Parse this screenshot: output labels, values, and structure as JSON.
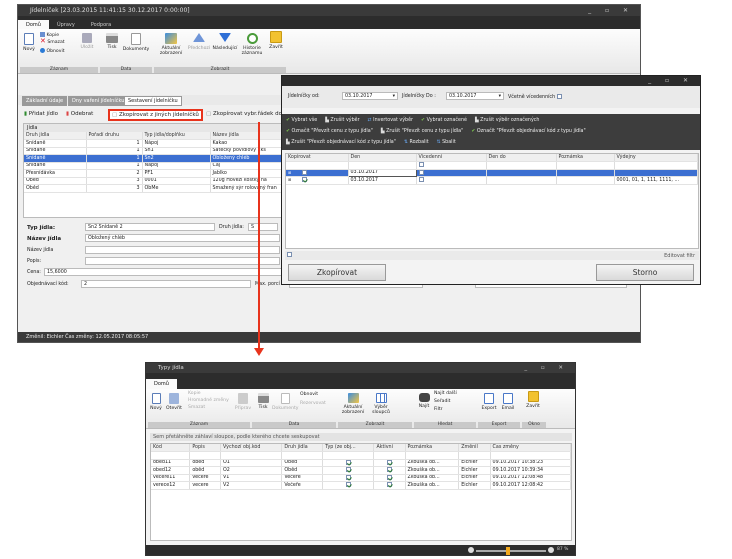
{
  "main": {
    "title": "Jídelníček [23.03.2015 11:41:15 30.12.2017 0:00:00]",
    "menu": [
      "Domů",
      "Úpravy",
      "Podpora"
    ],
    "ribbon": {
      "kopie": "Kopie",
      "smazat": "Smazat",
      "novy": "Nový",
      "obnovit": "Obnovit",
      "ulozit": "Uložit",
      "tisk": "Tisk",
      "dokumenty": "Dokumenty",
      "aktualni": "Aktuální zobrazení",
      "predchozi": "Předchozí",
      "nasledujici": "Následující",
      "historie": "Historie záznamu",
      "zavrit": "Zavřít",
      "groups": [
        "Záznam",
        "Data",
        "Zobrazit"
      ]
    },
    "tabs": [
      "Základní údaje",
      "Dny vaření jídelníčku",
      "Sestavení jídelníčku"
    ],
    "toolbar": {
      "pridat": "Přidat jídlo",
      "odebrat": "Odebrat",
      "zkopirovat": "Zkopírovat z jiných jídelníčků",
      "zkopirovat_vybr": "Zkopírovat vybr.řádek do"
    },
    "grid_title": "Jídla",
    "columns": [
      "Druh jídla",
      "Pořadí druhu",
      "Typ jídla/doplňku",
      "Název jídla"
    ],
    "rows": [
      [
        "Snídaně",
        "1",
        "Nápoj",
        "Kakao"
      ],
      [
        "Snídaně",
        "1",
        "Sn1",
        "Šátečky povidlový 2ks"
      ],
      [
        "Snídaně",
        "1",
        "Sn2",
        "Obložený chléb"
      ],
      [
        "Snídaně",
        "1",
        "Nápoj",
        "Čaj"
      ],
      [
        "Přesnídávka",
        "2",
        "PF1",
        "Jablko"
      ],
      [
        "Oběd",
        "3",
        "0001",
        "120g Hovězí kostky na"
      ],
      [
        "Oběd",
        "3",
        "ObMe",
        "Smažený sýr rolovaný fran"
      ]
    ],
    "form": {
      "typ_label": "Typ jídla:",
      "typ_value": "Sn2 Snídaně 2",
      "druh_label": "Druh jídla:",
      "druh_value": "S",
      "nazev_label": "Název jídla",
      "nazev_value": "Obložený chléb",
      "nazev2_label": "Název jídla",
      "popis_label": "Popis:",
      "cena_label": "Cena:",
      "cena_value": "15,6000",
      "obj_label": "Objednávací kód:",
      "obj_value": "2",
      "max_label": "Max. porcí ceny:",
      "max_value": "0",
      "denni_label": "Denní rezervace:",
      "denni_value": "6",
      "na_label": "Na"
    },
    "status": "Změnil: Eichler  Čas změny: 12.05.2017 08:05:57"
  },
  "dialog": {
    "od_label": "Jídelníčky od:",
    "od_value": "03.10.2017",
    "do_label": "Jídelníčky Do :",
    "do_value": "03.10.2017",
    "vcetne": "Včetně vícedenních",
    "actions1": [
      "Vybrat vše",
      "Zrušit výběr",
      "Invertovat výběr",
      "Vybrat označené",
      "Zrušit výběr označených"
    ],
    "actions2": [
      "Označit \"Převzít cenu z typu jídla\"",
      "Zrušit \"Převzít cenu z typu jídla\"",
      "Označit \"Převzít objednávací kód z typu jídla\""
    ],
    "actions3": [
      "Zrušit \"Převzít objednávací kód z typu jídla\"",
      "Rozbalit",
      "Sbalit"
    ],
    "columns": [
      "Kopírovat",
      "Den",
      "Vícedenní",
      "Den do",
      "Poznámka",
      "Výdejny"
    ],
    "rows": [
      {
        "den": "03.10.2017",
        "vydejny": "",
        "checked": false
      },
      {
        "den": "03.10.2017",
        "vydejny": "0001, 01, 1, 111, 1111, ...",
        "checked": true
      }
    ],
    "editovat": "Editovat filtr",
    "zkopirovat": "Zkopírovat",
    "storno": "Storno"
  },
  "second": {
    "title": "Typy jídla",
    "menu": [
      "Domů"
    ],
    "ribbon": {
      "novy": "Nový",
      "otevrit": "Otevřít",
      "kopie": "Kopie",
      "hromadne": "Hromadné změny",
      "smazat": "Smazat",
      "priprav": "Připrav",
      "tisk": "Tisk",
      "dokumenty": "Dokumenty",
      "obnovit": "Obnovit",
      "rezervovat": "Rezervovat",
      "aktualni": "Aktuální zobrazení",
      "vyber": "Výběr sloupců",
      "najit": "Najít",
      "najit_dalsi": "Najít další",
      "seradit": "Seřadit",
      "filtr": "Filtr",
      "export": "Export",
      "email": "Email",
      "zavrit": "Zavřít",
      "groups": [
        "Záznam",
        "Data",
        "Zobrazit",
        "Hledat",
        "Export",
        "Okno"
      ]
    },
    "hint": "Sem přetáhněte záhlaví sloupce, podle kterého chcete seskupovat",
    "columns": [
      "Kód",
      "Popis",
      "Výchozí obj.kód",
      "Druh jídla",
      "Typ (ze obj...",
      "Aktivní",
      "Poznámka",
      "Změnil",
      "Čas změny"
    ],
    "rows": [
      [
        "obed11",
        "oběd",
        "O1",
        "Oběd",
        "Zkouška ob...",
        "Eichler",
        "09.10.2017 10:38:23"
      ],
      [
        "obed12",
        "oběd",
        "O2",
        "Oběd",
        "Zkouška ob...",
        "Eichler",
        "09.10.2017 10:39:34"
      ],
      [
        "vecere11",
        "vecere",
        "V1",
        "Večeře",
        "Zkouška ob...",
        "Eichler",
        "09.10.2017 12:08:48"
      ],
      [
        "verece12",
        "vecere",
        "V2",
        "Večeře",
        "Zkouška ob...",
        "Eichler",
        "09.10.2017 12:08:42"
      ]
    ],
    "zoom": "87 %"
  },
  "colors": {
    "accent": "#3c6fd1",
    "highlight": "#e8331c",
    "titlebar": "#3a3a3a"
  }
}
